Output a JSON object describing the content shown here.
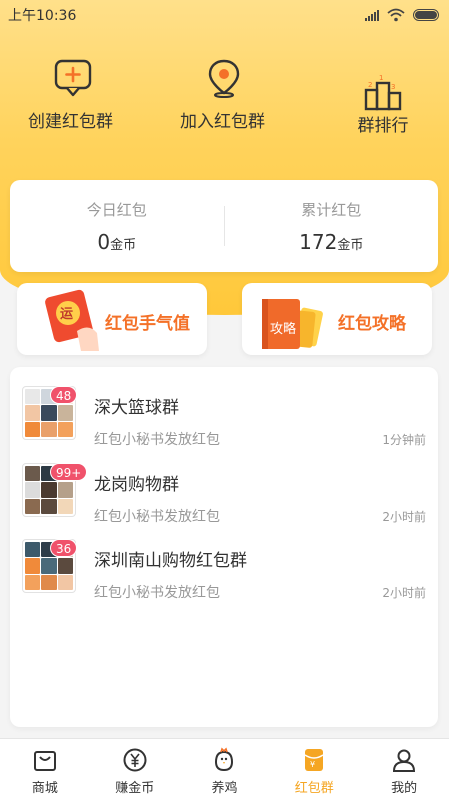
{
  "status_bar": {
    "time": "上午10:36"
  },
  "actions": [
    {
      "label": "创建红包群",
      "icon": "chat-plus-icon"
    },
    {
      "label": "加入红包群",
      "icon": "location-pin-icon"
    },
    {
      "label": "群排行",
      "icon": "podium-icon"
    }
  ],
  "stats": {
    "today": {
      "title": "今日红包",
      "value": "0",
      "unit": "金币"
    },
    "total": {
      "title": "累计红包",
      "value": "172",
      "unit": "金币"
    }
  },
  "promos": [
    {
      "title": "红包手气值",
      "icon": "red-envelope-luck-icon",
      "icon_text": "运"
    },
    {
      "title": "红包攻略",
      "icon": "guide-book-icon",
      "icon_text": "攻略"
    }
  ],
  "groups": [
    {
      "name": "深大篮球群",
      "subtitle": "红包小秘书发放红包",
      "time": "1分钟前",
      "badge": "48"
    },
    {
      "name": "龙岗购物群",
      "subtitle": "红包小秘书发放红包",
      "time": "2小时前",
      "badge": "99+"
    },
    {
      "name": "深圳南山购物红包群",
      "subtitle": "红包小秘书发放红包",
      "time": "2小时前",
      "badge": "36"
    }
  ],
  "tabs": [
    {
      "label": "商城",
      "icon": "shopping-bag-icon"
    },
    {
      "label": "赚金币",
      "icon": "yen-coin-icon"
    },
    {
      "label": "养鸡",
      "icon": "chicken-icon"
    },
    {
      "label": "红包群",
      "icon": "red-envelope-icon",
      "active": true
    },
    {
      "label": "我的",
      "icon": "user-icon"
    }
  ],
  "colors": {
    "accent": "#f5a623",
    "header_yellow": "#ffd35c",
    "badge_red": "#f0526b",
    "promo_orange": "#f47128"
  }
}
